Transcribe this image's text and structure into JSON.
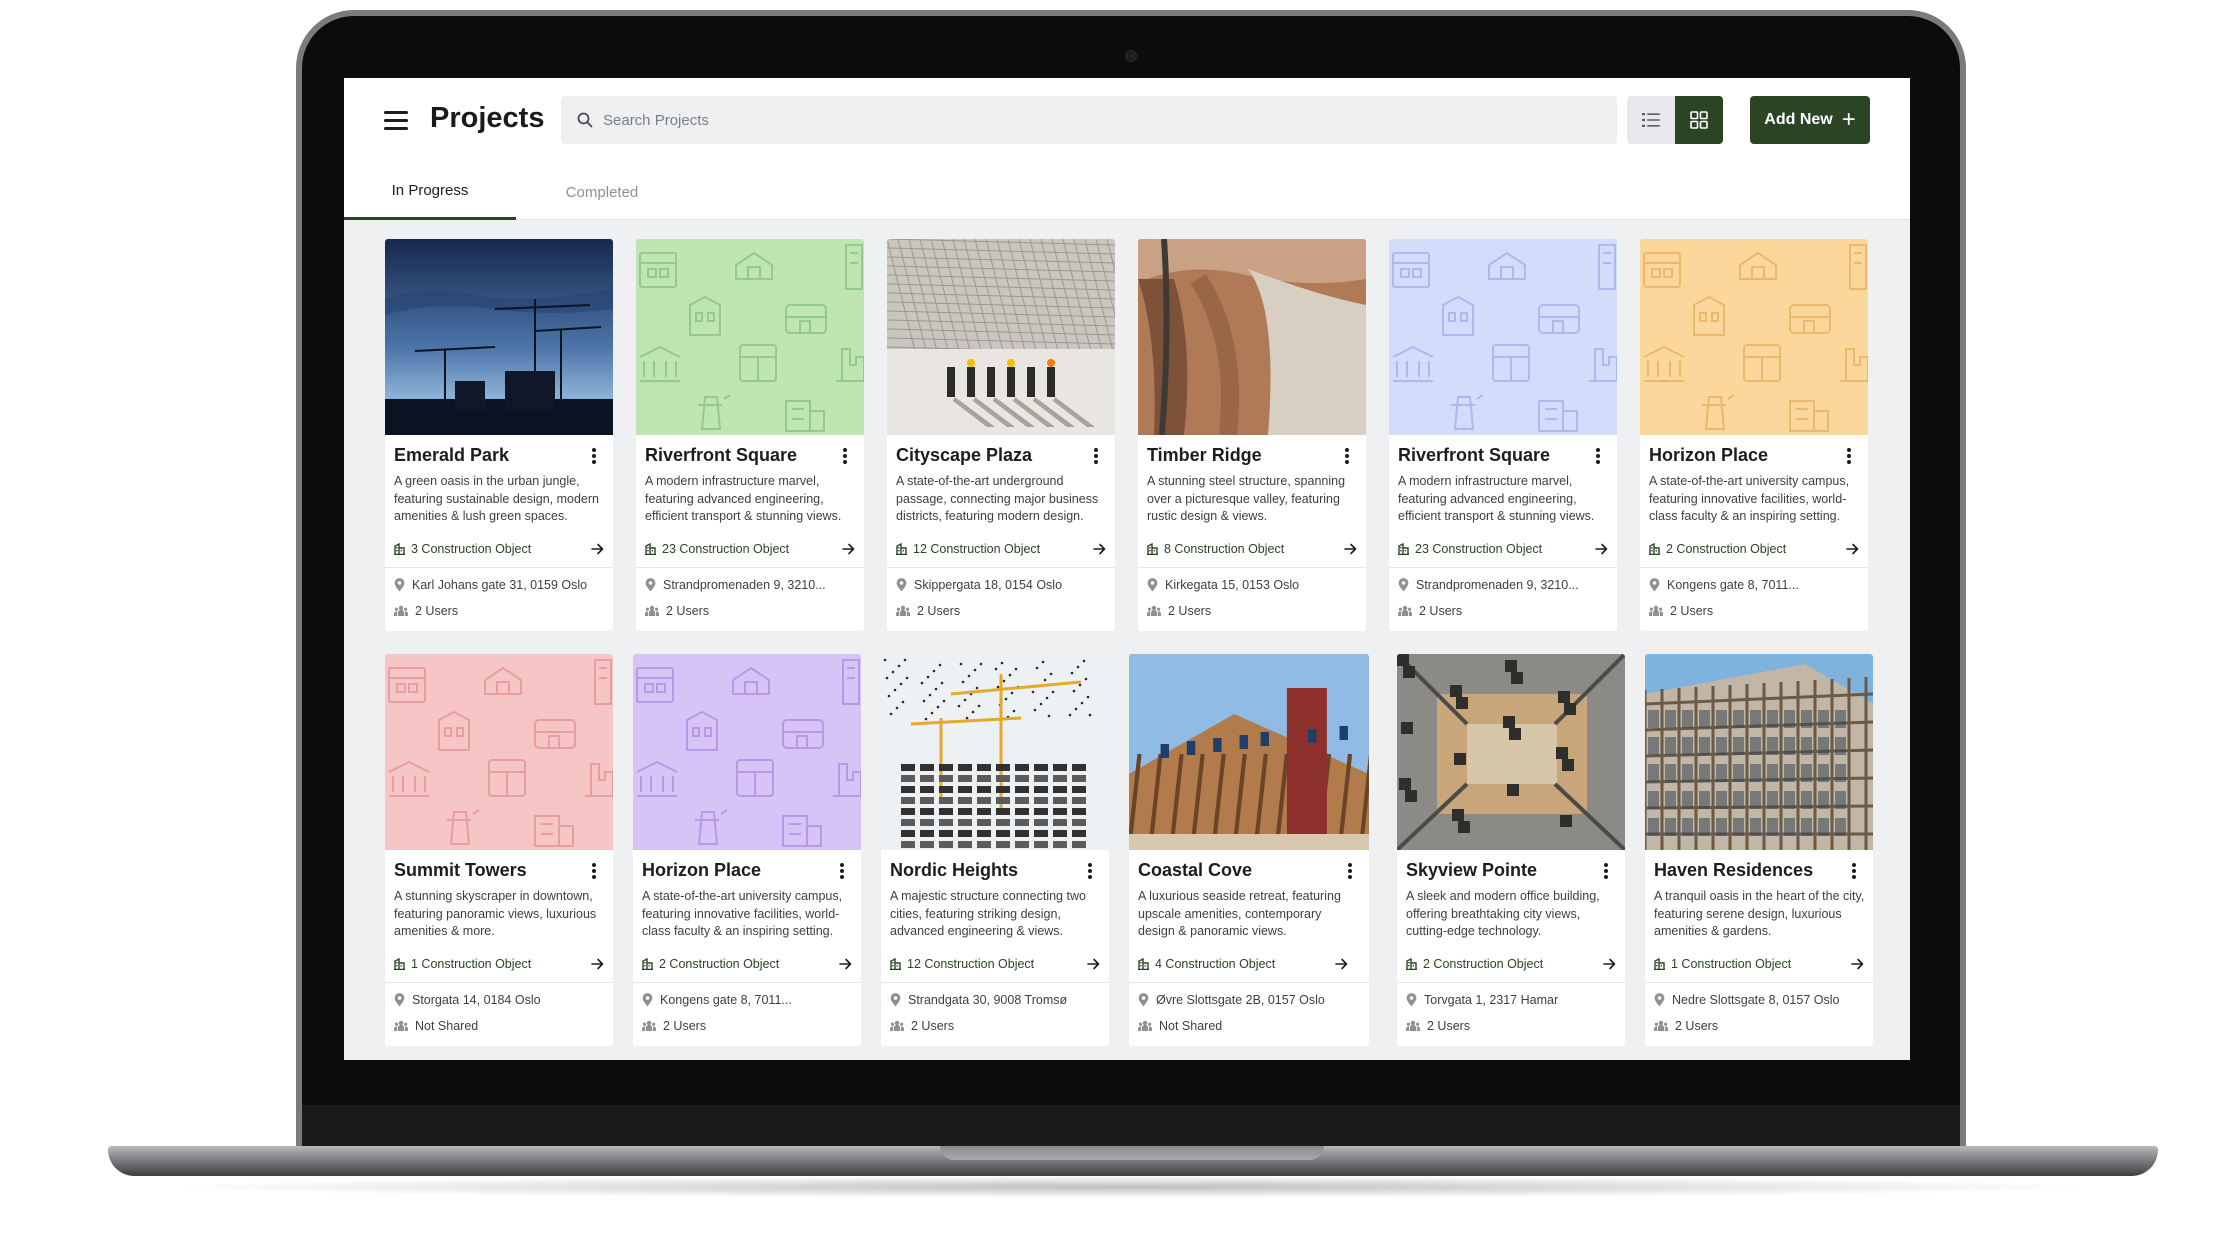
{
  "header": {
    "title": "Projects",
    "search_placeholder": "Search Projects",
    "add_label": "Add New",
    "brand_color": "#2b4424"
  },
  "tabs": [
    {
      "label": "In Progress",
      "active": true
    },
    {
      "label": "Completed",
      "active": false
    }
  ],
  "projects": [
    {
      "name": "Emerald Park",
      "description": "A green oasis in the urban jungle, featuring sustainable design, modern amenities & lush green spaces.",
      "objects": "3 Construction Object",
      "address": "Karl Johans gate 31, 0159 Oslo",
      "users": "2 Users",
      "image": "photo-cranes-dusk"
    },
    {
      "name": "Riverfront Square",
      "description": "A modern infrastructure marvel, featuring advanced engineering, efficient transport & stunning views.",
      "objects": "23 Construction Object",
      "address": "Strandpromenaden 9, 3210...",
      "users": "2 Users",
      "image": "pattern",
      "pattern_color": "#bfe5b3",
      "icon_color": "#8fc789"
    },
    {
      "name": "Cityscape Plaza",
      "description": "A state-of-the-art underground passage, connecting major business districts, featuring modern design.",
      "objects": "12 Construction Object",
      "address": "Skippergata 18, 0154 Oslo",
      "users": "2 Users",
      "image": "photo-rebar-workers"
    },
    {
      "name": "Timber Ridge",
      "description": "A stunning steel structure, spanning over a picturesque valley, featuring rustic design & views.",
      "objects": "8 Construction Object",
      "address": "Kirkegata 15, 0153 Oslo",
      "users": "2 Users",
      "image": "photo-canyon-dam"
    },
    {
      "name": "Riverfront Square",
      "description": "A modern infrastructure marvel, featuring advanced engineering, efficient transport & stunning views.",
      "objects": "23 Construction Object",
      "address": "Strandpromenaden 9, 3210...",
      "users": "2 Users",
      "image": "pattern",
      "pattern_color": "#d4dcfb",
      "icon_color": "#a9b6ec"
    },
    {
      "name": "Horizon Place",
      "description": "A state-of-the-art university campus, featuring innovative facilities, world-class faculty & an inspiring setting.",
      "objects": "2 Construction Object",
      "address": "Kongens gate 8, 7011...",
      "users": "2 Users",
      "image": "pattern",
      "pattern_color": "#fbd79c",
      "icon_color": "#eab66a"
    },
    {
      "name": "Summit Towers",
      "description": "A stunning skyscraper in downtown, featuring panoramic views, luxurious amenities & more.",
      "objects": "1 Construction Object",
      "address": "Storgata 14, 0184 Oslo",
      "users": "Not Shared",
      "image": "pattern",
      "pattern_color": "#f6c5c6",
      "icon_color": "#e59a9d"
    },
    {
      "name": "Horizon Place",
      "description": "A state-of-the-art university campus, featuring innovative facilities, world-class faculty & an inspiring setting.",
      "objects": "2 Construction Object",
      "address": "Kongens gate 8, 7011...",
      "users": "2 Users",
      "image": "pattern",
      "pattern_color": "#d7c3f5",
      "icon_color": "#b396e4"
    },
    {
      "name": "Nordic Heights",
      "description": "A majestic structure connecting two cities, featuring striking design, advanced engineering & views.",
      "objects": "12 Construction Object",
      "address": "Strandgata 30, 9008 Tromsø",
      "users": "2 Users",
      "image": "photo-crane-birds"
    },
    {
      "name": "Coastal Cove",
      "description": "A luxurious seaside retreat, featuring upscale amenities, contemporary design & panoramic views.",
      "objects": "4 Construction Object",
      "address": "Øvre Slottsgate 2B, 0157 Oslo",
      "users": "Not Shared",
      "image": "photo-timber-frame"
    },
    {
      "name": "Skyview Pointe",
      "description": "A sleek and modern office building, offering breathtaking city views, cutting-edge technology.",
      "objects": "2 Construction Object",
      "address": "Torvgata 1, 2317 Hamar",
      "users": "2 Users",
      "image": "photo-site-aerial"
    },
    {
      "name": "Haven Residences",
      "description": "A tranquil oasis in the heart of the city, featuring serene design, luxurious amenities & gardens.",
      "objects": "1 Construction Object",
      "address": "Nedre Slottsgate 8, 0157 Oslo",
      "users": "2 Users",
      "image": "photo-apartment-frame"
    }
  ]
}
